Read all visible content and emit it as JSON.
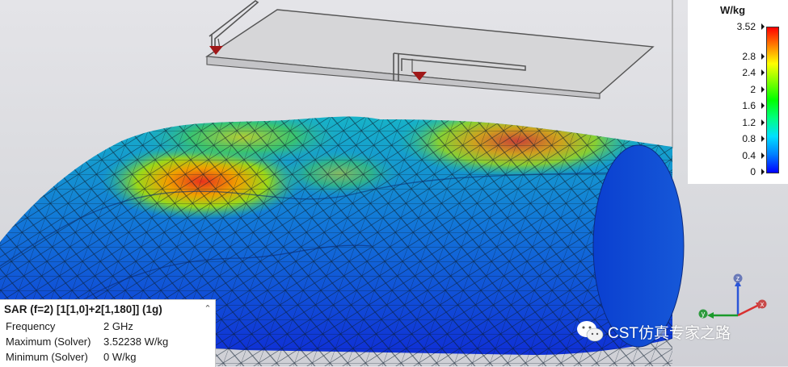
{
  "legend": {
    "unit": "W/kg",
    "ticks": [
      "3.52",
      "2.8",
      "2.4",
      "2",
      "1.6",
      "1.2",
      "0.8",
      "0.4",
      "0"
    ],
    "colors": [
      "#ff0000",
      "#ff8000",
      "#ffff00",
      "#80ff00",
      "#00ff00",
      "#00ff80",
      "#00e0ff",
      "#0080ff",
      "#0000ff"
    ]
  },
  "result": {
    "title": "SAR (f=2) [1[1,0]+2[1,180]] (1g)",
    "collapse_icon": "chevron-up-icon",
    "rows": [
      {
        "label": "Frequency",
        "value": "2 GHz"
      },
      {
        "label": "Maximum (Solver)",
        "value": "3.52238 W/kg"
      },
      {
        "label": "Minimum (Solver)",
        "value": "0 W/kg"
      }
    ]
  },
  "axes": {
    "x": "x",
    "y": "y",
    "z": "z"
  },
  "watermark": {
    "text": "CST仿真专家之路",
    "icon": "wechat-icon"
  }
}
